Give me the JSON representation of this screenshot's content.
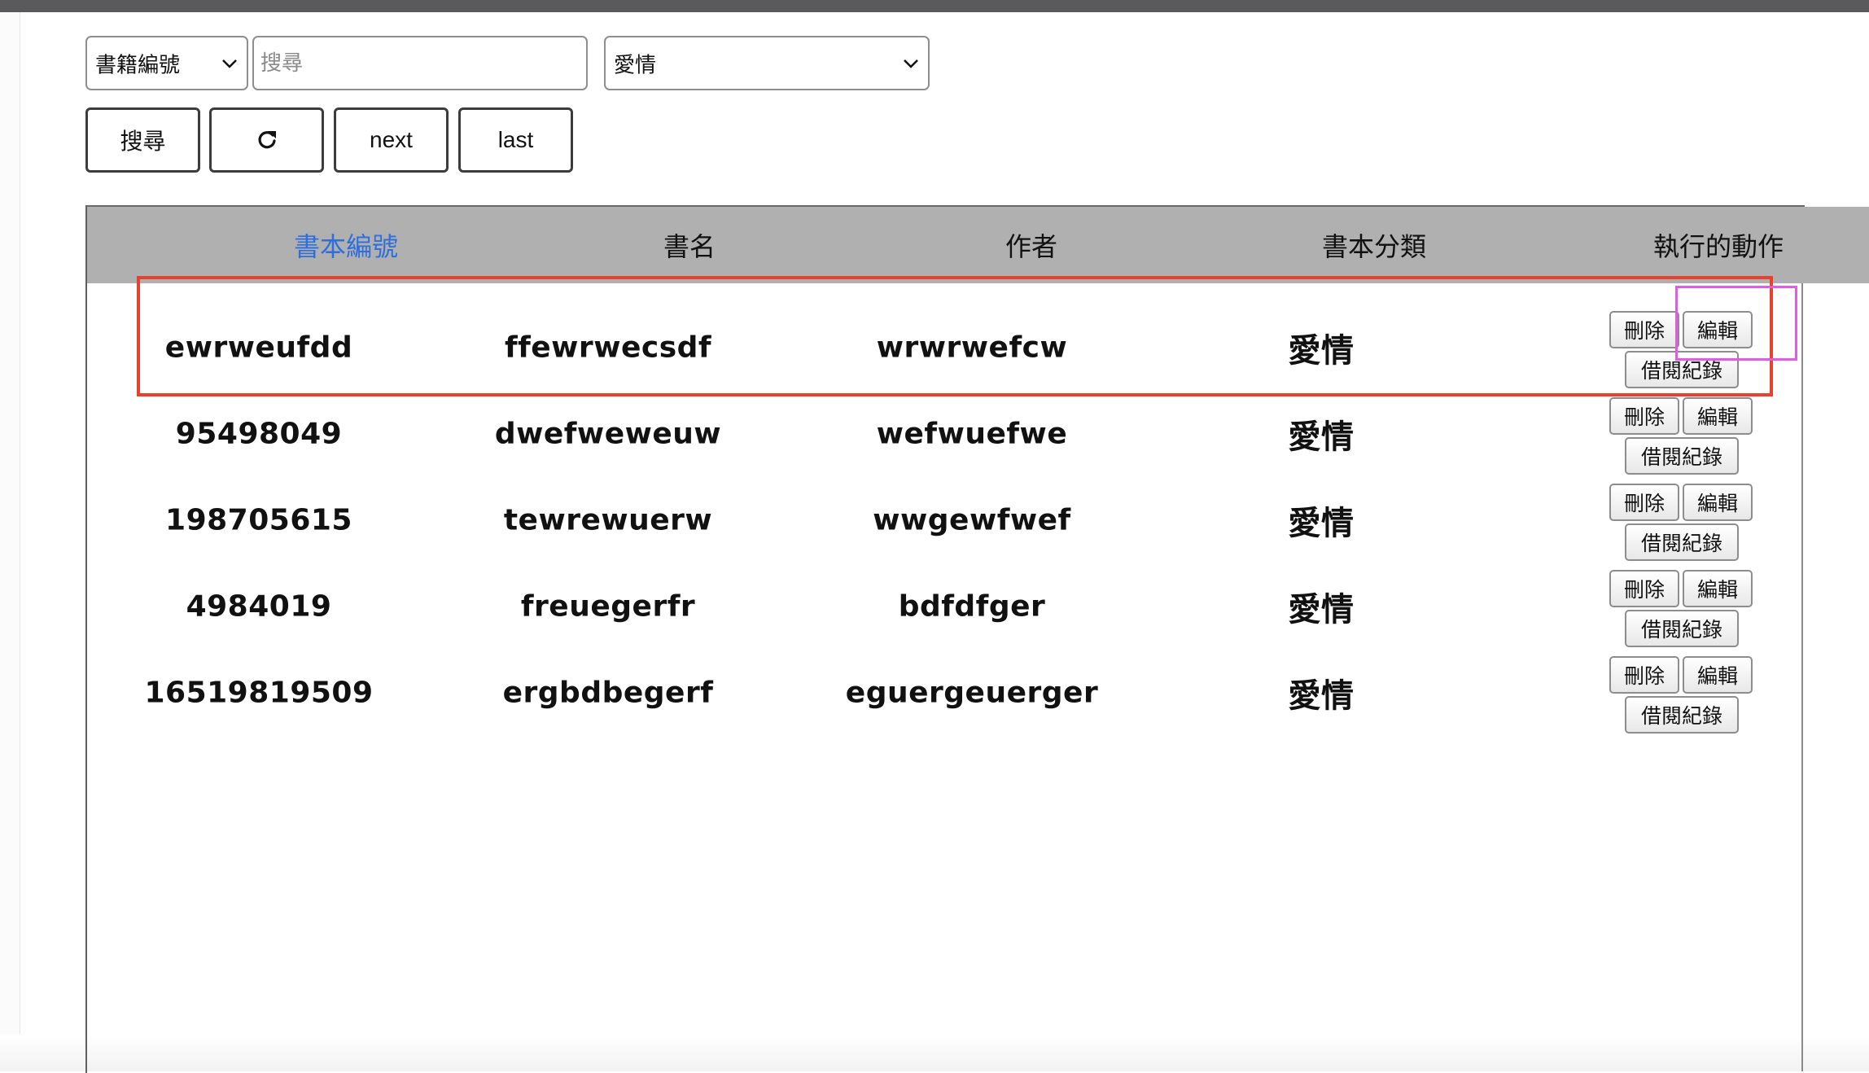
{
  "search": {
    "field_select_value": "書籍編號",
    "query_placeholder": "搜尋",
    "query_value": "",
    "category_select_value": "愛情"
  },
  "buttons": {
    "search_label": "搜尋",
    "refresh_icon": "refresh-icon",
    "next_label": "next",
    "last_label": "last"
  },
  "table": {
    "headers": [
      "書本編號",
      "書名",
      "作者",
      "書本分類",
      "執行的動作"
    ],
    "rows": [
      {
        "id": "ewrweufdd",
        "title": "ffewrwecsdf",
        "author": "wrwrwefcw",
        "category": "愛情"
      },
      {
        "id": "95498049",
        "title": "dwefweweuw",
        "author": "wefwuefwe",
        "category": "愛情"
      },
      {
        "id": "198705615",
        "title": "tewrewuerw",
        "author": "wwgewfwef",
        "category": "愛情"
      },
      {
        "id": "4984019",
        "title": "freuegerfr",
        "author": "bdfdfger",
        "category": "愛情"
      },
      {
        "id": "16519819509",
        "title": "ergbdbegerf",
        "author": "eguergeuerger",
        "category": "愛情"
      }
    ],
    "action_labels": {
      "delete": "刪除",
      "edit": "編輯",
      "history": "借閱紀錄"
    }
  },
  "annotations": {
    "row_highlight_color": "#e8412e",
    "button_highlight_color": "#e35be0"
  },
  "colors": {
    "header_bg": "#b0b0b0",
    "sort_link": "#2f6fdb",
    "top_bar": "#5a595b"
  }
}
